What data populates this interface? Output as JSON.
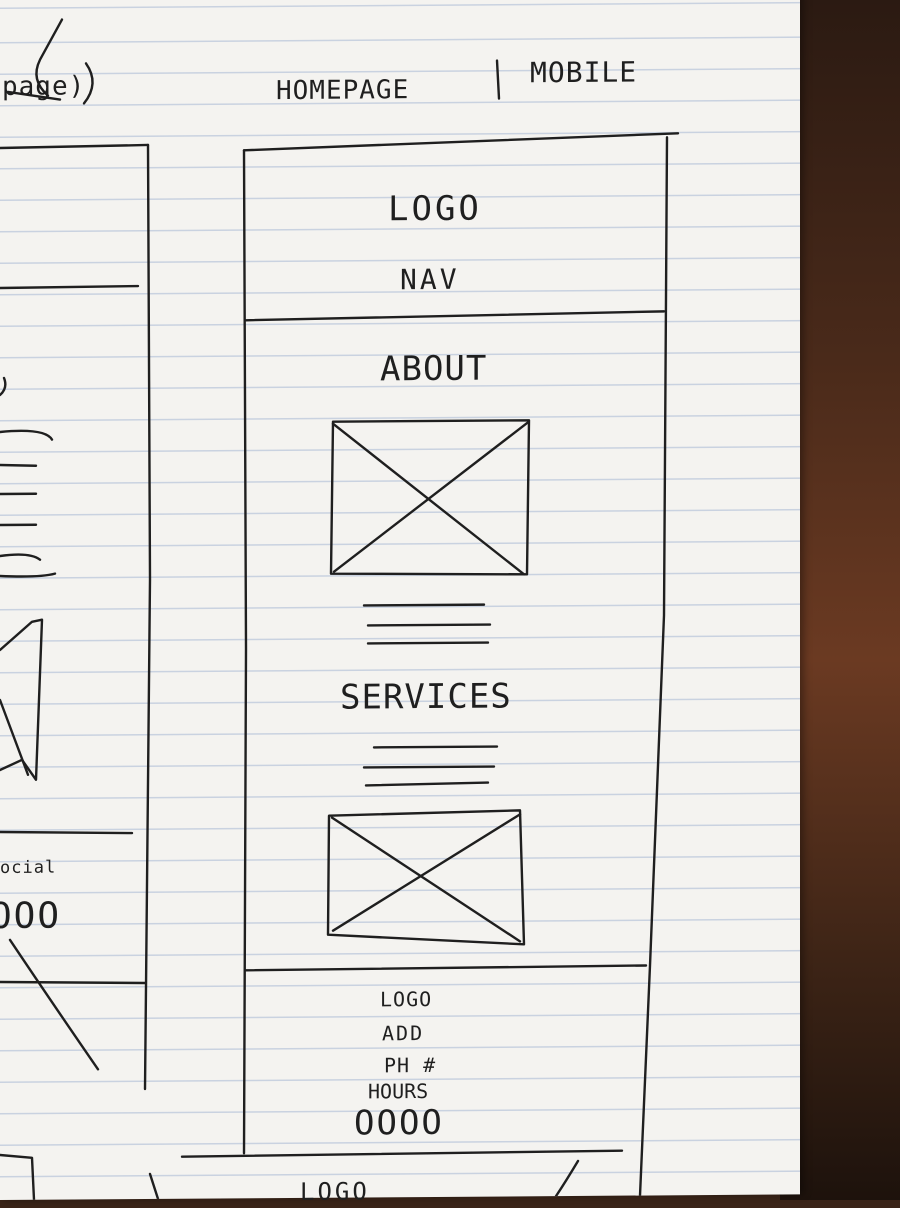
{
  "header": {
    "title": "HOMEPAGE",
    "separator": "|",
    "variant": "MOBILE",
    "left_page_fragment": "page)"
  },
  "wireframe": {
    "top": {
      "logo": "LOGO",
      "nav": "NAV"
    },
    "about": {
      "heading": "ABOUT"
    },
    "services": {
      "heading": "SERVICES"
    },
    "footer": {
      "logo": "LOGO",
      "address": "ADD",
      "phone": "PH #",
      "hours": "HOURS",
      "social_icons": "OOOO"
    },
    "next_page_fragment": "LOGO"
  },
  "left_wireframe_fragment": {
    "social_label": "ocial",
    "social_icons": "OOO"
  },
  "colors": {
    "paper": "#f4f3f0",
    "ink": "#1f1f1f",
    "rule_lines": "#c9d2e0",
    "table": "#4a2a1a"
  }
}
